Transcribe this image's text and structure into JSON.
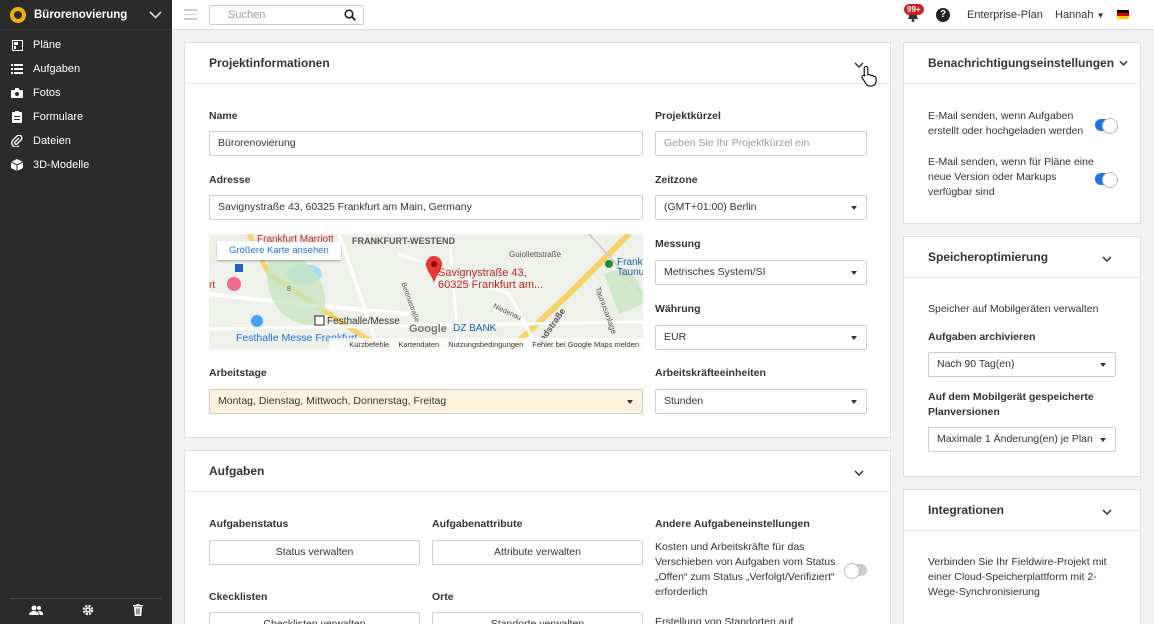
{
  "sidebar": {
    "project_name": "Bürorenovierung",
    "items": [
      {
        "label": "Pläne",
        "icon": "plans-icon"
      },
      {
        "label": "Aufgaben",
        "icon": "list-icon"
      },
      {
        "label": "Fotos",
        "icon": "camera-icon"
      },
      {
        "label": "Formulare",
        "icon": "clipboard-icon"
      },
      {
        "label": "Dateien",
        "icon": "paperclip-icon"
      },
      {
        "label": "3D-Modelle",
        "icon": "cube-icon"
      }
    ],
    "bottom_icons": [
      "users-icon",
      "gear-icon",
      "trash-icon"
    ]
  },
  "topbar": {
    "search_placeholder": "Suchen",
    "notification_count": "99+",
    "help": "?",
    "plan": "Enterprise-Plan",
    "user": "Hannah",
    "colors": {
      "badge": "#d01f1f",
      "accent": "#1a73e8"
    }
  },
  "project_info": {
    "title": "Projektinformationen",
    "name_label": "Name",
    "name_value": "Bürorenovierung",
    "code_label": "Projektkürzel",
    "code_placeholder": "Geben Sie Ihr Projektkürzel ein",
    "address_label": "Adresse",
    "address_value": "Savignystraße 43, 60325 Frankfurt am Main, Germany",
    "timezone_label": "Zeitzone",
    "timezone_value": "(GMT+01:00) Berlin",
    "measure_label": "Messung",
    "measure_value": "Metrisches System/SI",
    "currency_label": "Währung",
    "currency_value": "EUR",
    "workdays_label": "Arbeitstage",
    "workdays_value": "Montag, Dienstag, Mittwoch, Donnerstag, Freitag",
    "labor_label": "Arbeitskräfteeinheiten",
    "labor_value": "Stunden",
    "map": {
      "larger_map": "Größere Karte ansehen",
      "pin_line1": "Savignystraße 43,",
      "pin_line2": "60325 Frankfurt am...",
      "labels": [
        "Frankfurt Marriott",
        "FRANKFURT-WESTEND",
        "Guiollettstraße",
        "Frankf",
        "Taunu",
        "Festhalle/Messe",
        "Festhalle Messe Frankfurt",
        "DZ BANK",
        "Bettinastraße",
        "Niedenau",
        "Taunusanlage",
        "undstraße",
        "8",
        "rt"
      ],
      "google": "Google",
      "footer": [
        "Kurzbefehle",
        "Kartendaten",
        "Nutzungsbedingungen",
        "Fehler bei Google Maps melden"
      ]
    }
  },
  "tasks": {
    "title": "Aufgaben",
    "status_label": "Aufgabenstatus",
    "status_btn": "Status verwalten",
    "attr_label": "Aufgabenattribute",
    "attr_btn": "Attribute verwalten",
    "other_label": "Andere Aufgabeneinstellungen",
    "other_text": "Kosten und Arbeitskräfte für das Verschieben von Aufgaben vom Status „Offen“ zum Status „Verfolgt/Verifiziert“ erforderlich",
    "other_toggle": false,
    "checklists_label": "Ckecklisten",
    "checklists_btn": "Checklisten verwalten",
    "places_label": "Orte",
    "places_btn": "Standorte verwalten",
    "places_text": "Erstellung von Standorten auf"
  },
  "notifications": {
    "title": "Benachrichtigungseinstellungen",
    "items": [
      {
        "text": "E-Mail senden, wenn Aufgaben erstellt oder hochgeladen werden",
        "on": true
      },
      {
        "text": "E-Mail senden, wenn für Pläne eine neue Version oder Markups verfügbar sind",
        "on": true
      }
    ]
  },
  "storage": {
    "title": "Speicheroptimierung",
    "subtitle": "Speicher auf Mobilgeräten verwalten",
    "archive_label": "Aufgaben archivieren",
    "archive_value": "Nach 90 Tag(en)",
    "versions_label": "Auf dem Mobilgerät gespeicherte Planversionen",
    "versions_value": "Maximale 1 Änderung(en) je Plan"
  },
  "integrations": {
    "title": "Integrationen",
    "text": "Verbinden Sie Ihr Fieldwire-Projekt mit einer Cloud-Speicherplattform mit 2-Wege-Synchronisierung"
  }
}
